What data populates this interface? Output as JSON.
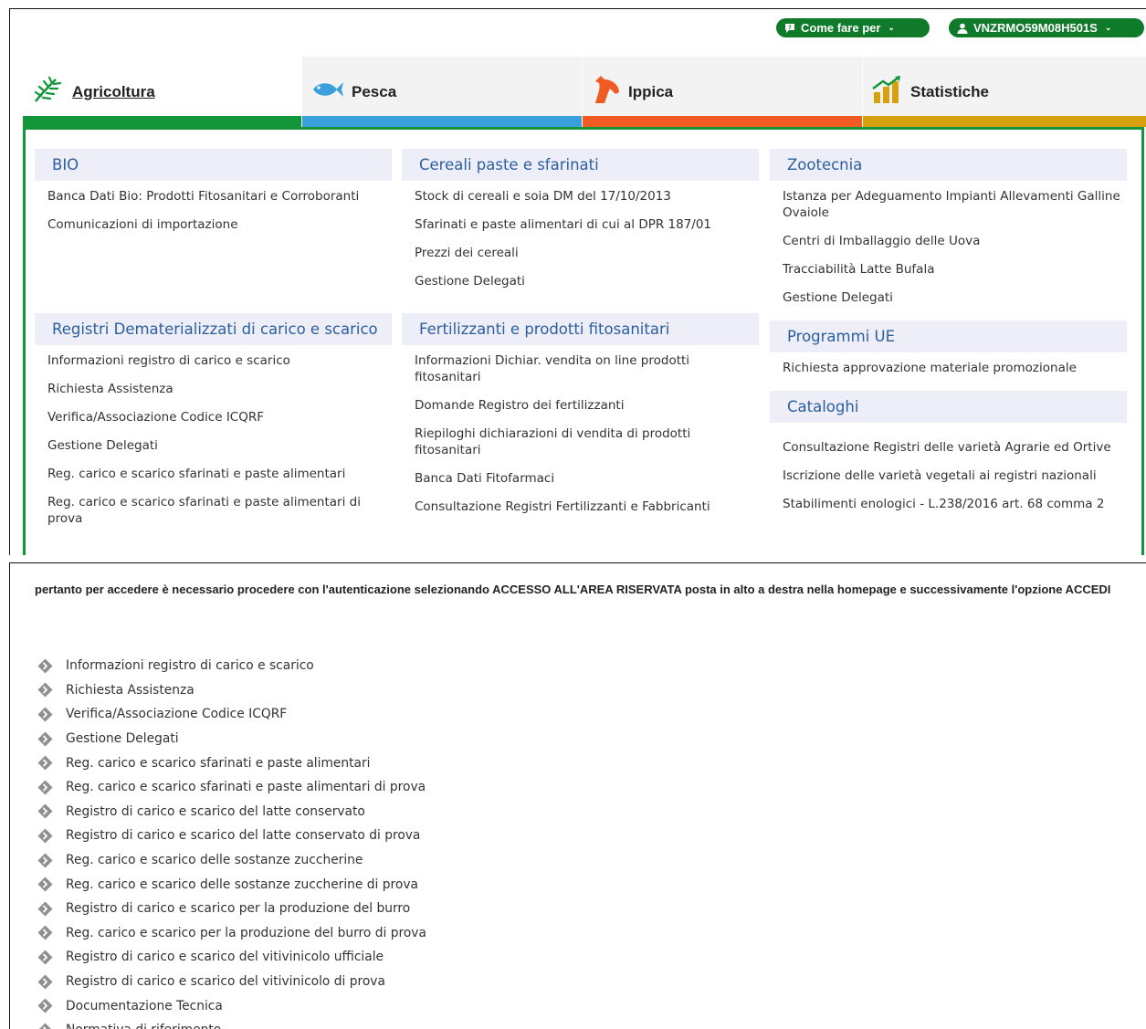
{
  "header": {
    "help_label": "Come fare per",
    "user_label": "VNZRMO59M08H501S"
  },
  "tabs": [
    {
      "label": "Agricoltura",
      "icon": "wheat-icon",
      "color": "#13953a"
    },
    {
      "label": "Pesca",
      "icon": "fish-icon",
      "color": "#3aa0dd"
    },
    {
      "label": "Ippica",
      "icon": "horse-icon",
      "color": "#f05a23"
    },
    {
      "label": "Statistiche",
      "icon": "chart-icon",
      "color": "#d7a00f"
    }
  ],
  "columns": [
    [
      {
        "title": "BIO",
        "items": [
          "Banca Dati Bio: Prodotti Fitosanitari e Corroboranti",
          "Comunicazioni di importazione"
        ]
      },
      {
        "title": "Registri Dematerializzati di carico e scarico",
        "items": [
          "Informazioni registro di carico e scarico",
          "Richiesta Assistenza",
          "Verifica/Associazione Codice ICQRF",
          "Gestione Delegati",
          "Reg. carico e scarico sfarinati e paste alimentari",
          "Reg. carico e scarico sfarinati e paste alimentari di prova"
        ]
      }
    ],
    [
      {
        "title": "Cereali paste e sfarinati",
        "items": [
          "Stock di cereali e soia DM del 17/10/2013",
          "Sfarinati e paste alimentari di cui al DPR 187/01",
          "Prezzi dei cereali",
          "Gestione Delegati"
        ]
      },
      {
        "title": "Fertilizzanti e prodotti fitosanitari",
        "items": [
          "Informazioni Dichiar. vendita on line prodotti fitosanitari",
          "Domande Registro dei fertilizzanti",
          "Riepiloghi dichiarazioni di vendita di prodotti fitosanitari",
          "Banca Dati Fitofarmaci",
          "Consultazione Registri Fertilizzanti e Fabbricanti"
        ]
      }
    ],
    [
      {
        "title": "Zootecnia",
        "items": [
          "Istanza per Adeguamento Impianti Allevamenti Galline Ovaiole",
          "Centri di Imballaggio delle Uova",
          "Tracciabilità Latte Bufala",
          "Gestione Delegati"
        ]
      },
      {
        "title": "Programmi UE",
        "items": [
          "Richiesta approvazione materiale promozionale"
        ]
      },
      {
        "title": "Cataloghi",
        "items": [
          "Consultazione Registri delle varietà Agrarie ed Ortive",
          "Iscrizione delle varietà vegetali ai registri nazionali",
          "Stabilimenti enologici - L.238/2016 art. 68 comma 2"
        ]
      }
    ]
  ],
  "notice": "pertanto per accedere è necessario procedere con l'autenticazione selezionando ACCESSO ALL'AREA RISERVATA posta in alto a destra nella homepage e successivamente l'opzione ACCEDI",
  "registry_links": [
    "Informazioni registro di carico e scarico",
    "Richiesta Assistenza",
    "Verifica/Associazione Codice ICQRF",
    "Gestione Delegati",
    "Reg. carico e scarico sfarinati e paste alimentari",
    "Reg. carico e scarico sfarinati e paste alimentari di prova",
    "Registro di carico e scarico del latte conservato",
    "Registro di carico e scarico del latte conservato di prova",
    "Reg. carico e scarico delle sostanze zuccherine",
    "Reg. carico e scarico delle sostanze zuccherine di prova",
    "Registro di carico e scarico per la produzione del burro",
    "Reg. carico e scarico per la produzione del burro di prova",
    "Registro di carico e scarico del vitivinicolo ufficiale",
    "Registro di carico e scarico del vitivinicolo di prova",
    "Documentazione Tecnica",
    "Normativa di riferimento"
  ],
  "colors": {
    "brand_green": "#0e7a2a",
    "link_blue": "#2a5f9e",
    "category_bg": "#eeeef8",
    "bullet_gray": "#8f8f8f"
  }
}
